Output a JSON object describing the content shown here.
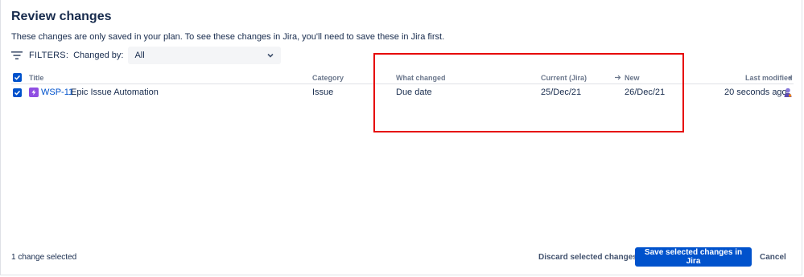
{
  "dialog": {
    "title": "Review changes",
    "subtitle": "These changes are only saved in your plan. To see these changes in Jira, you'll need to save these in Jira first."
  },
  "filters": {
    "label": "FILTERS:",
    "changed_by_label": "Changed by:",
    "changed_by_value": "All"
  },
  "table": {
    "headers": {
      "title": "Title",
      "category": "Category",
      "what_changed": "What changed",
      "current": "Current (Jira)",
      "new": "New",
      "last_modified": "Last modified"
    },
    "rows": [
      {
        "key": "WSP-11",
        "summary": "Epic Issue Automation",
        "category": "Issue",
        "what_changed": "Due date",
        "current": "25/Dec/21",
        "new": "26/Dec/21",
        "last_modified": "20 seconds ago",
        "selected": true
      }
    ]
  },
  "footer": {
    "selected_count": "1 change selected",
    "discard_label": "Discard selected changes",
    "save_label": "Save selected changes in Jira",
    "cancel_label": "Cancel"
  },
  "colors": {
    "primary": "#0052cc",
    "epic": "#904ee2",
    "highlight": "#e60000",
    "text": "#172b4d",
    "muted": "#6b778c"
  }
}
